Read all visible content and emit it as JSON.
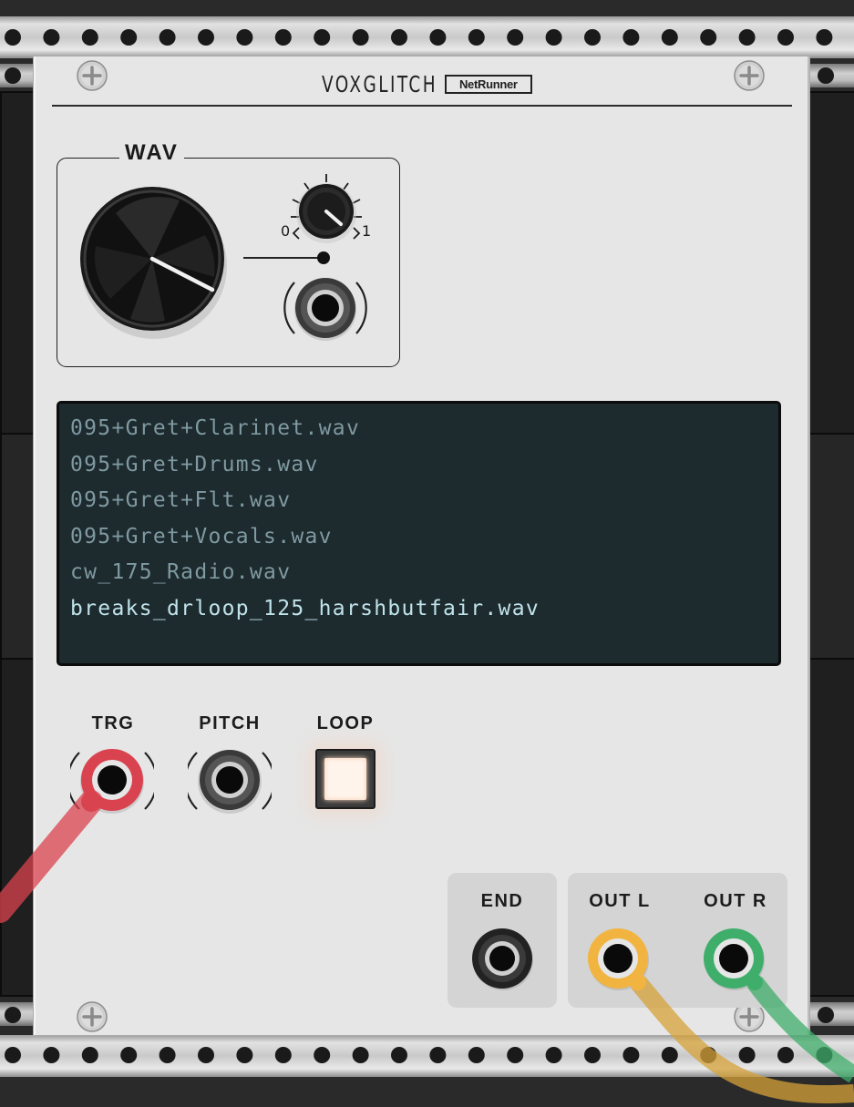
{
  "module": {
    "brand": "VOXGLITCH",
    "name": "NetRunner"
  },
  "wav_section": {
    "title": "WAV",
    "attenuator_min": "0",
    "attenuator_max": "1"
  },
  "file_list": {
    "rows": [
      "095+Gret+Clarinet.wav",
      "095+Gret+Drums.wav",
      "095+Gret+Flt.wav",
      "095+Gret+Vocals.wav",
      "cw_175_Radio.wav",
      "breaks_drloop_125_harshbutfair.wav"
    ],
    "selected_index": 5
  },
  "inputs": {
    "trg": "TRG",
    "pitch": "PITCH",
    "loop": "LOOP"
  },
  "outputs": {
    "end": "END",
    "out_l": "OUT L",
    "out_r": "OUT R"
  },
  "colors": {
    "panel": "#e6e6e6",
    "lcd_bg": "#1d2a2e",
    "lcd_text": "#7f9aa1",
    "lcd_selected": "#bfe3ea",
    "cable_trg": "#d9434f",
    "cable_out_l": "#f2b441",
    "cable_out_r": "#3fae6a"
  }
}
